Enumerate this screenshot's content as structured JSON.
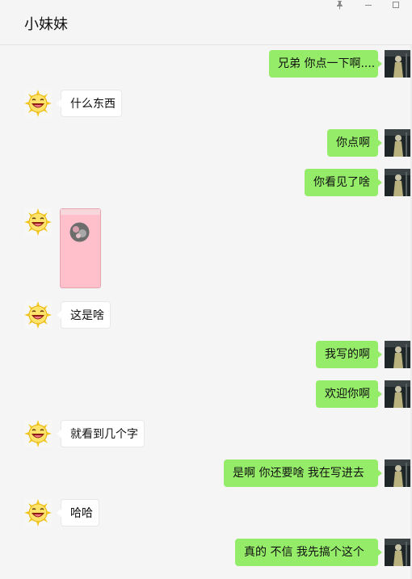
{
  "window": {
    "title": "小妹妹",
    "controls": {
      "pin_icon": "pin-icon",
      "minimize_icon": "minimize-icon",
      "maximize_icon": "maximize-icon"
    }
  },
  "colors": {
    "outgoing_bubble": "#95ec69",
    "incoming_bubble": "#ffffff",
    "background": "#f5f5f5",
    "image_message": "#ffc0cb"
  },
  "messages": [
    {
      "side": "out",
      "text": "兄弟 你点一下啊...."
    },
    {
      "side": "in",
      "text": "什么东西"
    },
    {
      "side": "out",
      "text": "你点啊"
    },
    {
      "side": "out",
      "text": "你看见了啥"
    },
    {
      "side": "in",
      "type": "image",
      "text": ""
    },
    {
      "side": "in",
      "text": "这是啥"
    },
    {
      "side": "out",
      "text": "我写的啊"
    },
    {
      "side": "out",
      "text": "欢迎你啊"
    },
    {
      "side": "in",
      "text": "就看到几个字"
    },
    {
      "side": "out",
      "text": "是啊  你还要啥  我在写进去"
    },
    {
      "side": "in",
      "text": "哈哈"
    },
    {
      "side": "out",
      "text": "真的    不信 我先搞个这个"
    }
  ]
}
